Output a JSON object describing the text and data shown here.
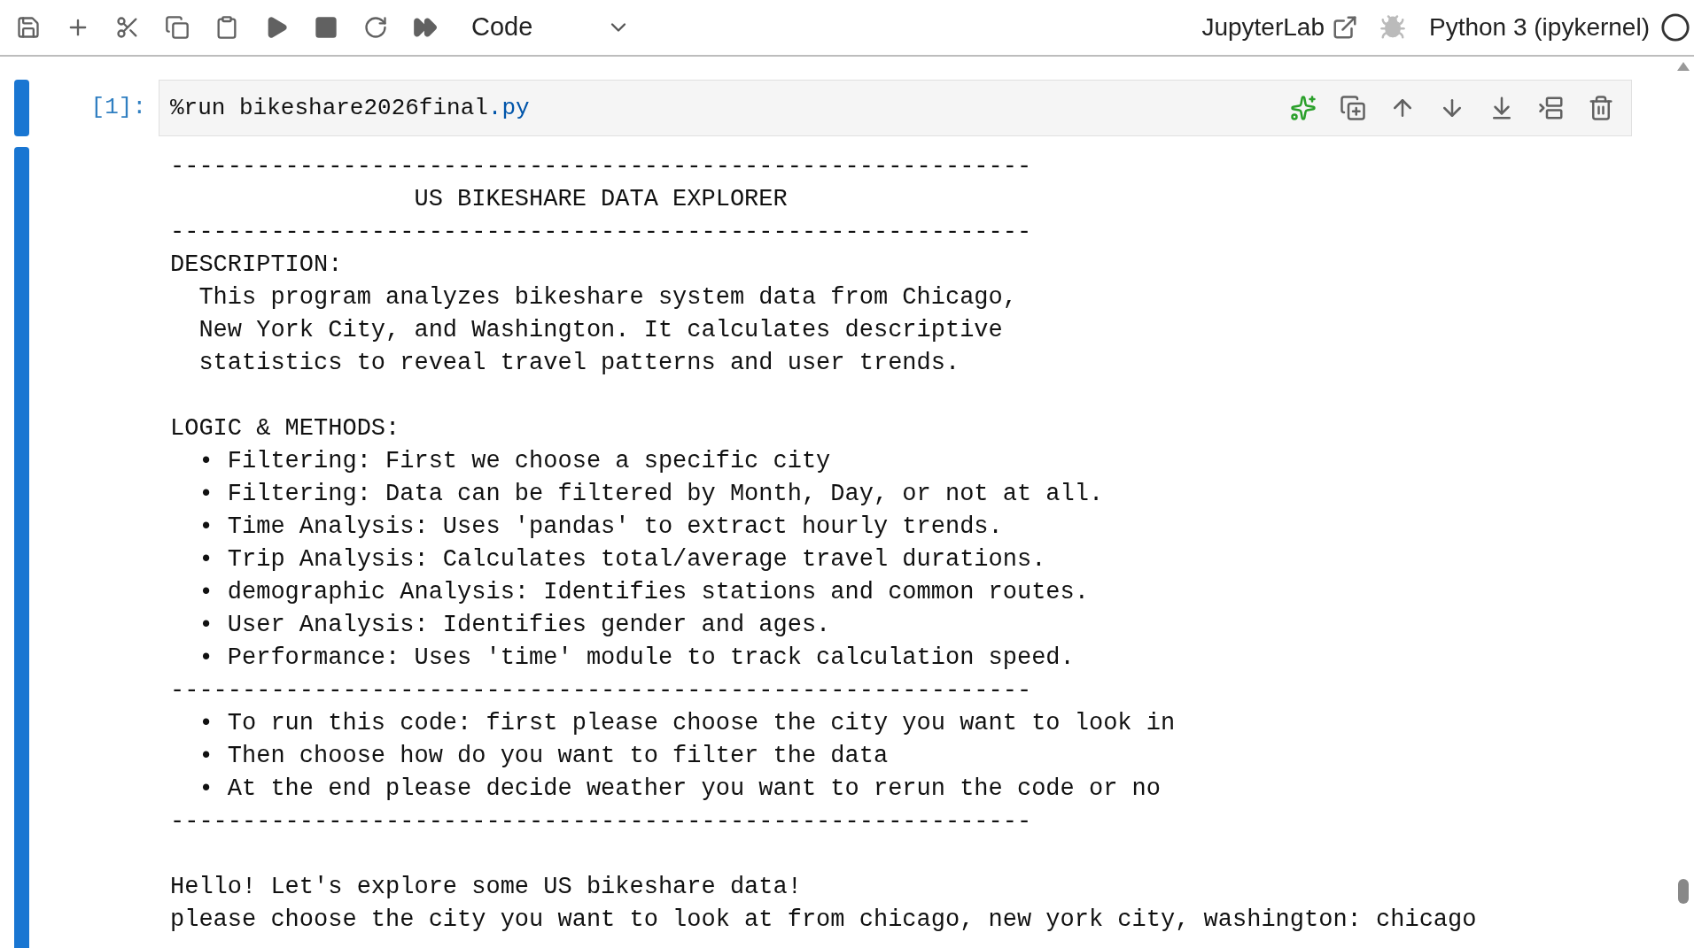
{
  "toolbar": {
    "cell_type": "Code",
    "launcher_label": "JupyterLab",
    "kernel": "Python 3 (ipykernel)"
  },
  "cell": {
    "prompt": "[1]:",
    "code": "%run bikeshare2026final",
    "code_ext": ".py"
  },
  "output": [
    {
      "kind": "text",
      "text": "------------------------------------------------------------"
    },
    {
      "kind": "text",
      "text": "                 US BIKESHARE DATA EXPLORER"
    },
    {
      "kind": "text",
      "text": "------------------------------------------------------------"
    },
    {
      "kind": "text",
      "text": "DESCRIPTION:"
    },
    {
      "kind": "text",
      "text": "  This program analyzes bikeshare system data from Chicago,"
    },
    {
      "kind": "text",
      "text": "  New York City, and Washington. It calculates descriptive"
    },
    {
      "kind": "text",
      "text": "  statistics to reveal travel patterns and user trends."
    },
    {
      "kind": "blank"
    },
    {
      "kind": "text",
      "text": "LOGIC & METHODS:"
    },
    {
      "kind": "text",
      "text": "  • Filtering: First we choose a specific city"
    },
    {
      "kind": "text",
      "text": "  • Filtering: Data can be filtered by Month, Day, or not at all."
    },
    {
      "kind": "text",
      "text": "  • Time Analysis: Uses 'pandas' to extract hourly trends."
    },
    {
      "kind": "text",
      "text": "  • Trip Analysis: Calculates total/average travel durations."
    },
    {
      "kind": "text",
      "text": "  • demographic Analysis: Identifies stations and common routes."
    },
    {
      "kind": "text",
      "text": "  • User Analysis: Identifies gender and ages."
    },
    {
      "kind": "text",
      "text": "  • Performance: Uses 'time' module to track calculation speed."
    },
    {
      "kind": "text",
      "text": "------------------------------------------------------------"
    },
    {
      "kind": "text",
      "text": "  • To run this code: first please choose the city you want to look in"
    },
    {
      "kind": "text",
      "text": "  • Then choose how do you want to filter the data"
    },
    {
      "kind": "text",
      "text": "  • At the end please decide weather you want to rerun the code or no"
    },
    {
      "kind": "text",
      "text": "------------------------------------------------------------"
    },
    {
      "kind": "blank"
    },
    {
      "kind": "text",
      "text": "Hello! Let's explore some US bikeshare data!"
    },
    {
      "kind": "text",
      "text": "please choose the city you want to look at from chicago, new york city, washington: chicago"
    }
  ]
}
